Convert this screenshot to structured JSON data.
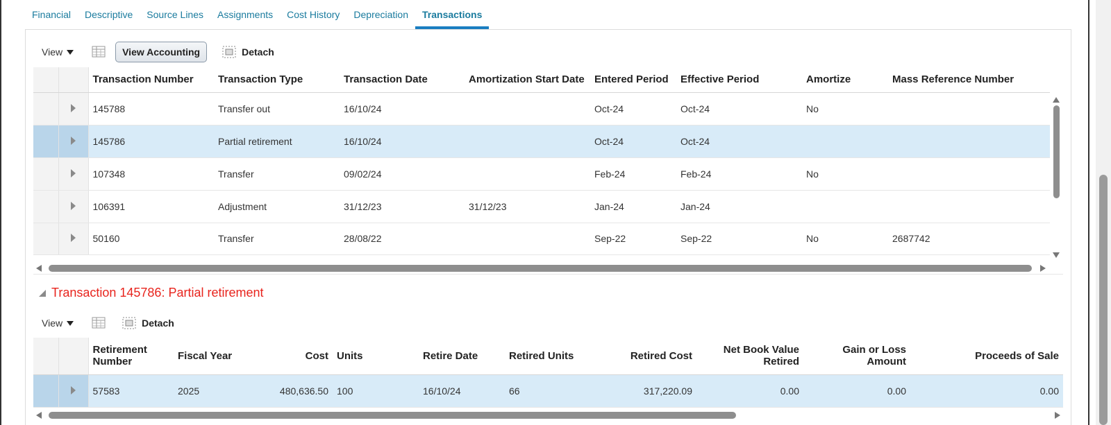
{
  "tabs": [
    "Financial",
    "Descriptive",
    "Source Lines",
    "Assignments",
    "Cost History",
    "Depreciation",
    "Transactions"
  ],
  "active_tab": "Transactions",
  "toolbar": {
    "view_label": "View",
    "view_accounting_label": "View Accounting",
    "detach_label": "Detach"
  },
  "transactions": {
    "columns": [
      "Transaction Number",
      "Transaction Type",
      "Transaction Date",
      "Amortization Start Date",
      "Entered Period",
      "Effective Period",
      "Amortize",
      "Mass Reference Number"
    ],
    "rows": [
      [
        "145788",
        "Transfer out",
        "16/10/24",
        "",
        "Oct-24",
        "Oct-24",
        "No",
        ""
      ],
      [
        "145786",
        "Partial retirement",
        "16/10/24",
        "",
        "Oct-24",
        "Oct-24",
        "",
        ""
      ],
      [
        "107348",
        "Transfer",
        "09/02/24",
        "",
        "Feb-24",
        "Feb-24",
        "No",
        ""
      ],
      [
        "106391",
        "Adjustment",
        "31/12/23",
        "31/12/23",
        "Jan-24",
        "Jan-24",
        "",
        ""
      ],
      [
        "50160",
        "Transfer",
        "28/08/22",
        "",
        "Sep-22",
        "Sep-22",
        "No",
        "2687742"
      ]
    ],
    "selected_row": 1
  },
  "detail": {
    "title": "Transaction 145786: Partial retirement",
    "view_label": "View",
    "detach_label": "Detach",
    "columns": [
      "Retirement Number",
      "Fiscal Year",
      "Cost",
      "Units",
      "Retire Date",
      "Retired Units",
      "Retired Cost",
      "Net Book Value Retired",
      "Gain or Loss Amount",
      "Proceeds of Sale"
    ],
    "rows": [
      [
        "57583",
        "2025",
        "480,636.50",
        "100",
        "16/10/24",
        "66",
        "317,220.09",
        "0.00",
        "0.00",
        "0.00"
      ]
    ]
  },
  "icons": {
    "view_caret": "caret-down-icon",
    "columns": "freeze-columns-icon",
    "detach": "detach-icon",
    "expand": "expand-arrow-icon"
  }
}
